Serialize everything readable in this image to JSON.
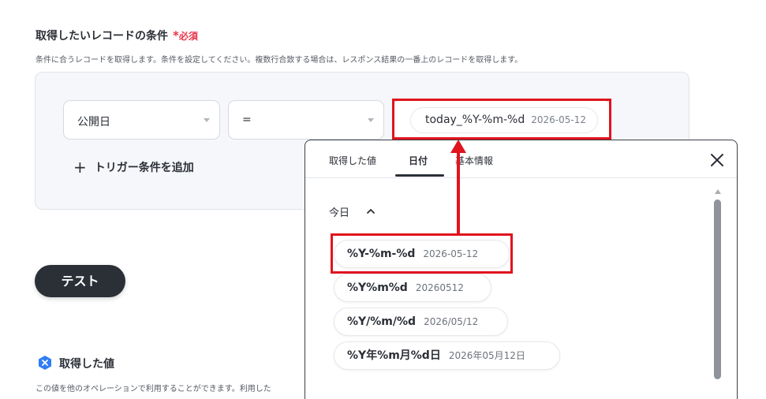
{
  "condition": {
    "title": "取得したいレコードの条件",
    "required_star": "*",
    "required_label": "必須",
    "description": "条件に合うレコードを取得します。条件を設定してください。複数行合致する場合は、レスポンス結果の一番上のレコードを取得します。",
    "field_select": "公開日",
    "operator_select": "=",
    "value_chip_format": "today_%Y-%m-%d",
    "value_chip_example": "2026-05-12",
    "add_trigger_icon": "+",
    "add_trigger_label": "トリガー条件を追加"
  },
  "test_button": "テスト",
  "obtained": {
    "title": "取得した値",
    "description": "この値を他のオペレーションで利用することができます。利用した"
  },
  "popup": {
    "tabs": [
      "取得した値",
      "日付",
      "基本情報"
    ],
    "active_tab": "日付",
    "group_title": "今日",
    "options": [
      {
        "format": "%Y-%m-%d",
        "example": "2026-05-12"
      },
      {
        "format": "%Y%m%d",
        "example": "20260512"
      },
      {
        "format": "%Y/%m/%d",
        "example": "2026/05/12"
      },
      {
        "format": "%Y年%m月%d日",
        "example": "2026年05月12日"
      }
    ]
  },
  "colors": {
    "highlight": "#e0141e",
    "required": "#e8334a",
    "dark": "#2b2f36",
    "badge_blue": "#2f7cf6"
  },
  "icons": {
    "close": "close-icon",
    "collapse": "chevron-up-icon",
    "obtained": "hexagon-x-icon",
    "select_caret": "caret-down-icon"
  }
}
